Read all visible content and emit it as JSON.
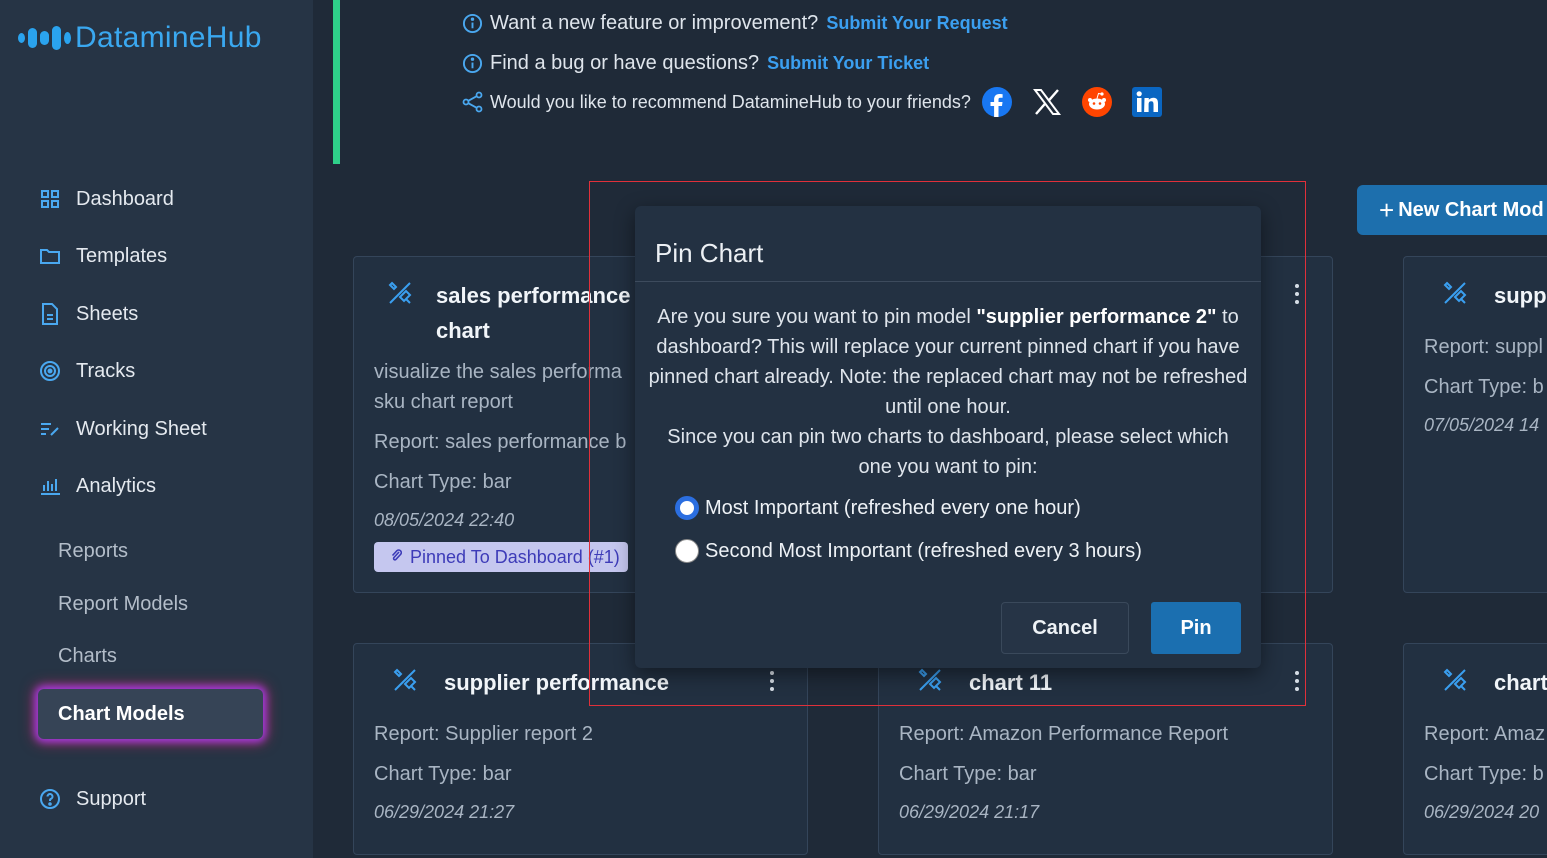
{
  "app": {
    "logo_text": "DatamineHub",
    "accent": "#3aa8f0"
  },
  "sidebar": {
    "items": [
      {
        "label": "Dashboard",
        "icon": "grid-icon"
      },
      {
        "label": "Templates",
        "icon": "folder-icon"
      },
      {
        "label": "Sheets",
        "icon": "document-icon"
      },
      {
        "label": "Tracks",
        "icon": "target-icon"
      },
      {
        "label": "Working Sheet",
        "icon": "list-edit-icon"
      },
      {
        "label": "Analytics",
        "icon": "bar-chart-icon"
      }
    ],
    "sub_items": [
      "Reports",
      "Report Models",
      "Charts",
      "Chart Models"
    ],
    "active": "Chart Models",
    "support": "Support"
  },
  "info": {
    "feature_text": "Want a new feature or improvement?",
    "feature_link": "Submit Your Request",
    "bug_text": "Find a bug or have questions?",
    "bug_link": "Submit Your Ticket",
    "share_text": "Would you like to recommend DatamineHub to your friends?",
    "socials": [
      "facebook-icon",
      "x-icon",
      "reddit-icon",
      "linkedin-icon"
    ]
  },
  "toolbar": {
    "new_button": "New Chart Mod"
  },
  "cards": [
    {
      "title_line1": "sales performance",
      "title_line2": "chart",
      "desc_line1": "visualize the sales performa",
      "desc_line2": "sku chart report",
      "report": "Report: sales performance b",
      "type": "Chart Type: bar",
      "date": "08/05/2024 22:40",
      "badge": "Pinned To Dashboard (#1)"
    },
    {
      "title": "supp",
      "report": "Report: suppl",
      "type": "Chart Type: b",
      "date": "07/05/2024 14"
    },
    {
      "title": "supplier performance",
      "report": "Report: Supplier report 2",
      "type": "Chart Type: bar",
      "date": "06/29/2024 21:27"
    },
    {
      "title": "chart 11",
      "report": "Report: Amazon Performance Report",
      "type": "Chart Type: bar",
      "date": "06/29/2024 21:17"
    },
    {
      "title": "chart",
      "report": "Report: Amaz",
      "type": "Chart Type: b",
      "date": "06/29/2024 20"
    }
  ],
  "modal": {
    "title": "Pin Chart",
    "body_prefix": "Are you sure you want to pin model ",
    "model_name": "\"supplier performance 2\"",
    "body_rest": "to dashboard? This will replace your current pinned chart if you have pinned chart already. Note: the replaced chart may not be refreshed until one hour.",
    "body2": "Since you can pin two charts to dashboard, please select which one you want to pin:",
    "options": [
      {
        "label": "Most Important (refreshed every one hour)",
        "selected": true
      },
      {
        "label": "Second Most Important (refreshed every 3 hours)",
        "selected": false
      }
    ],
    "cancel": "Cancel",
    "confirm": "Pin"
  }
}
